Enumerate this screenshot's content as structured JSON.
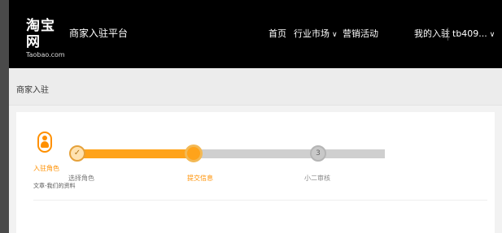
{
  "header": {
    "logo_main": "淘宝网",
    "logo_sub": "Taobao.com",
    "platform": "商家入驻平台",
    "nav": {
      "home": "首页",
      "market": "行业市场",
      "event": "营销活动",
      "mine": "我的入驻",
      "user": "tb409..."
    }
  },
  "subheader": {
    "title": "商家入驻"
  },
  "progress": {
    "side_step": {
      "label": "入驻角色",
      "desc": "文章-我们的资料"
    },
    "steps": [
      {
        "number": "",
        "label": "选择角色",
        "status": "done"
      },
      {
        "number": "",
        "label": "提交信息",
        "status": "current"
      },
      {
        "number": "3",
        "label": "小二审核",
        "status": "pending"
      }
    ],
    "completed_fraction": 0.38
  },
  "colors": {
    "accent": "#ff9000",
    "track_done": "#ffa31a",
    "track_pending": "#cfcfcf",
    "header_bg": "#000000"
  },
  "icons": {
    "check": "✓",
    "chevron": "∨"
  }
}
